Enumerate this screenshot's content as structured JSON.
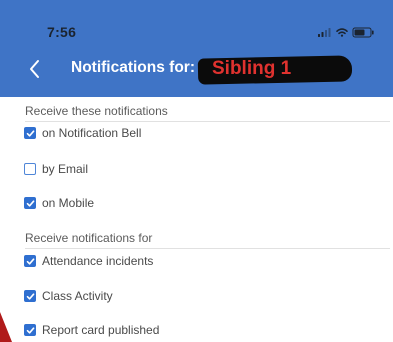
{
  "status_bar": {
    "time": "7:56"
  },
  "header": {
    "title": "Notifications for:",
    "redacted_label": "Sibling 1",
    "accent_color": "#3f74c6",
    "back_icon": "chevron-left-icon"
  },
  "sections": [
    {
      "title": "Receive these notifications",
      "options": [
        {
          "label": "on Notification Bell",
          "checked": true
        },
        {
          "label": "by Email",
          "checked": false
        },
        {
          "label": "on Mobile",
          "checked": true
        }
      ]
    },
    {
      "title": "Receive notifications for",
      "options": [
        {
          "label": "Attendance incidents",
          "checked": true
        },
        {
          "label": "Class Activity",
          "checked": true
        },
        {
          "label": "Report card published",
          "checked": true
        }
      ]
    }
  ]
}
